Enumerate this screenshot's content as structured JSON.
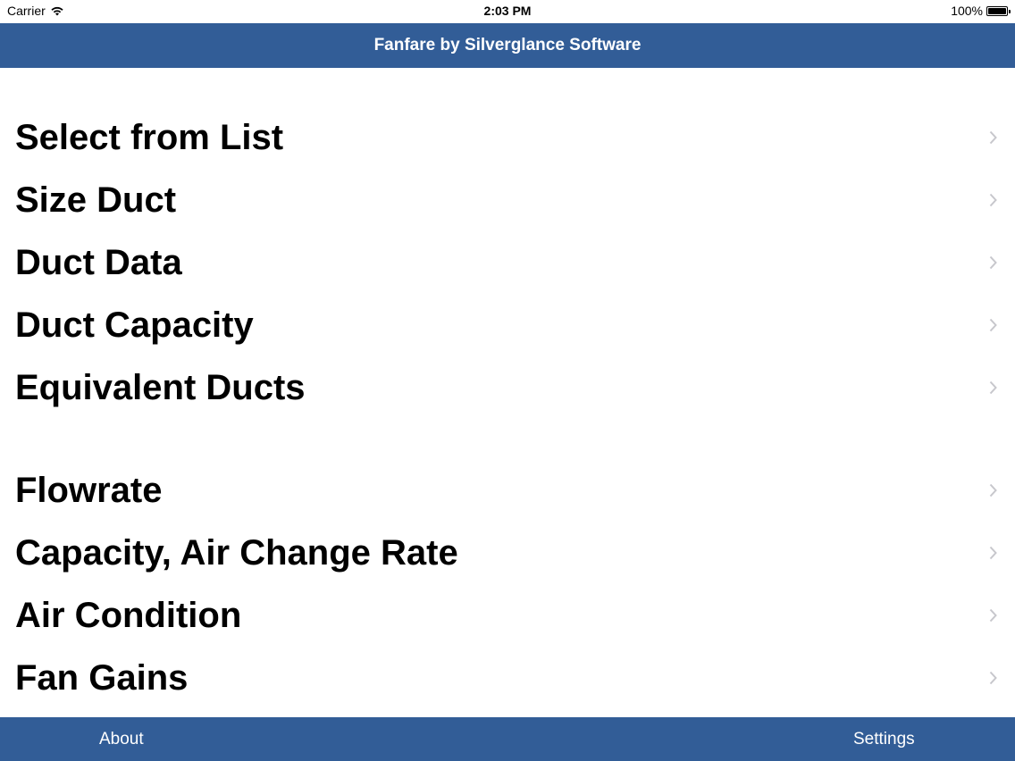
{
  "status_bar": {
    "carrier": "Carrier",
    "time": "2:03 PM",
    "battery": "100%",
    "wifi_icon": "wifi-icon",
    "battery_icon": "battery-full-icon"
  },
  "nav": {
    "title": "Fanfare by Silverglance Software",
    "color": "#325d97"
  },
  "sections": [
    {
      "items": [
        {
          "label": "Select from List"
        },
        {
          "label": "Size Duct"
        },
        {
          "label": "Duct Data"
        },
        {
          "label": "Duct Capacity"
        },
        {
          "label": "Equivalent Ducts"
        }
      ]
    },
    {
      "items": [
        {
          "label": "Flowrate"
        },
        {
          "label": "Capacity, Air Change Rate"
        },
        {
          "label": "Air Condition"
        },
        {
          "label": "Fan Gains"
        }
      ]
    }
  ],
  "bottom_bar": {
    "about_label": "About",
    "settings_label": "Settings"
  }
}
